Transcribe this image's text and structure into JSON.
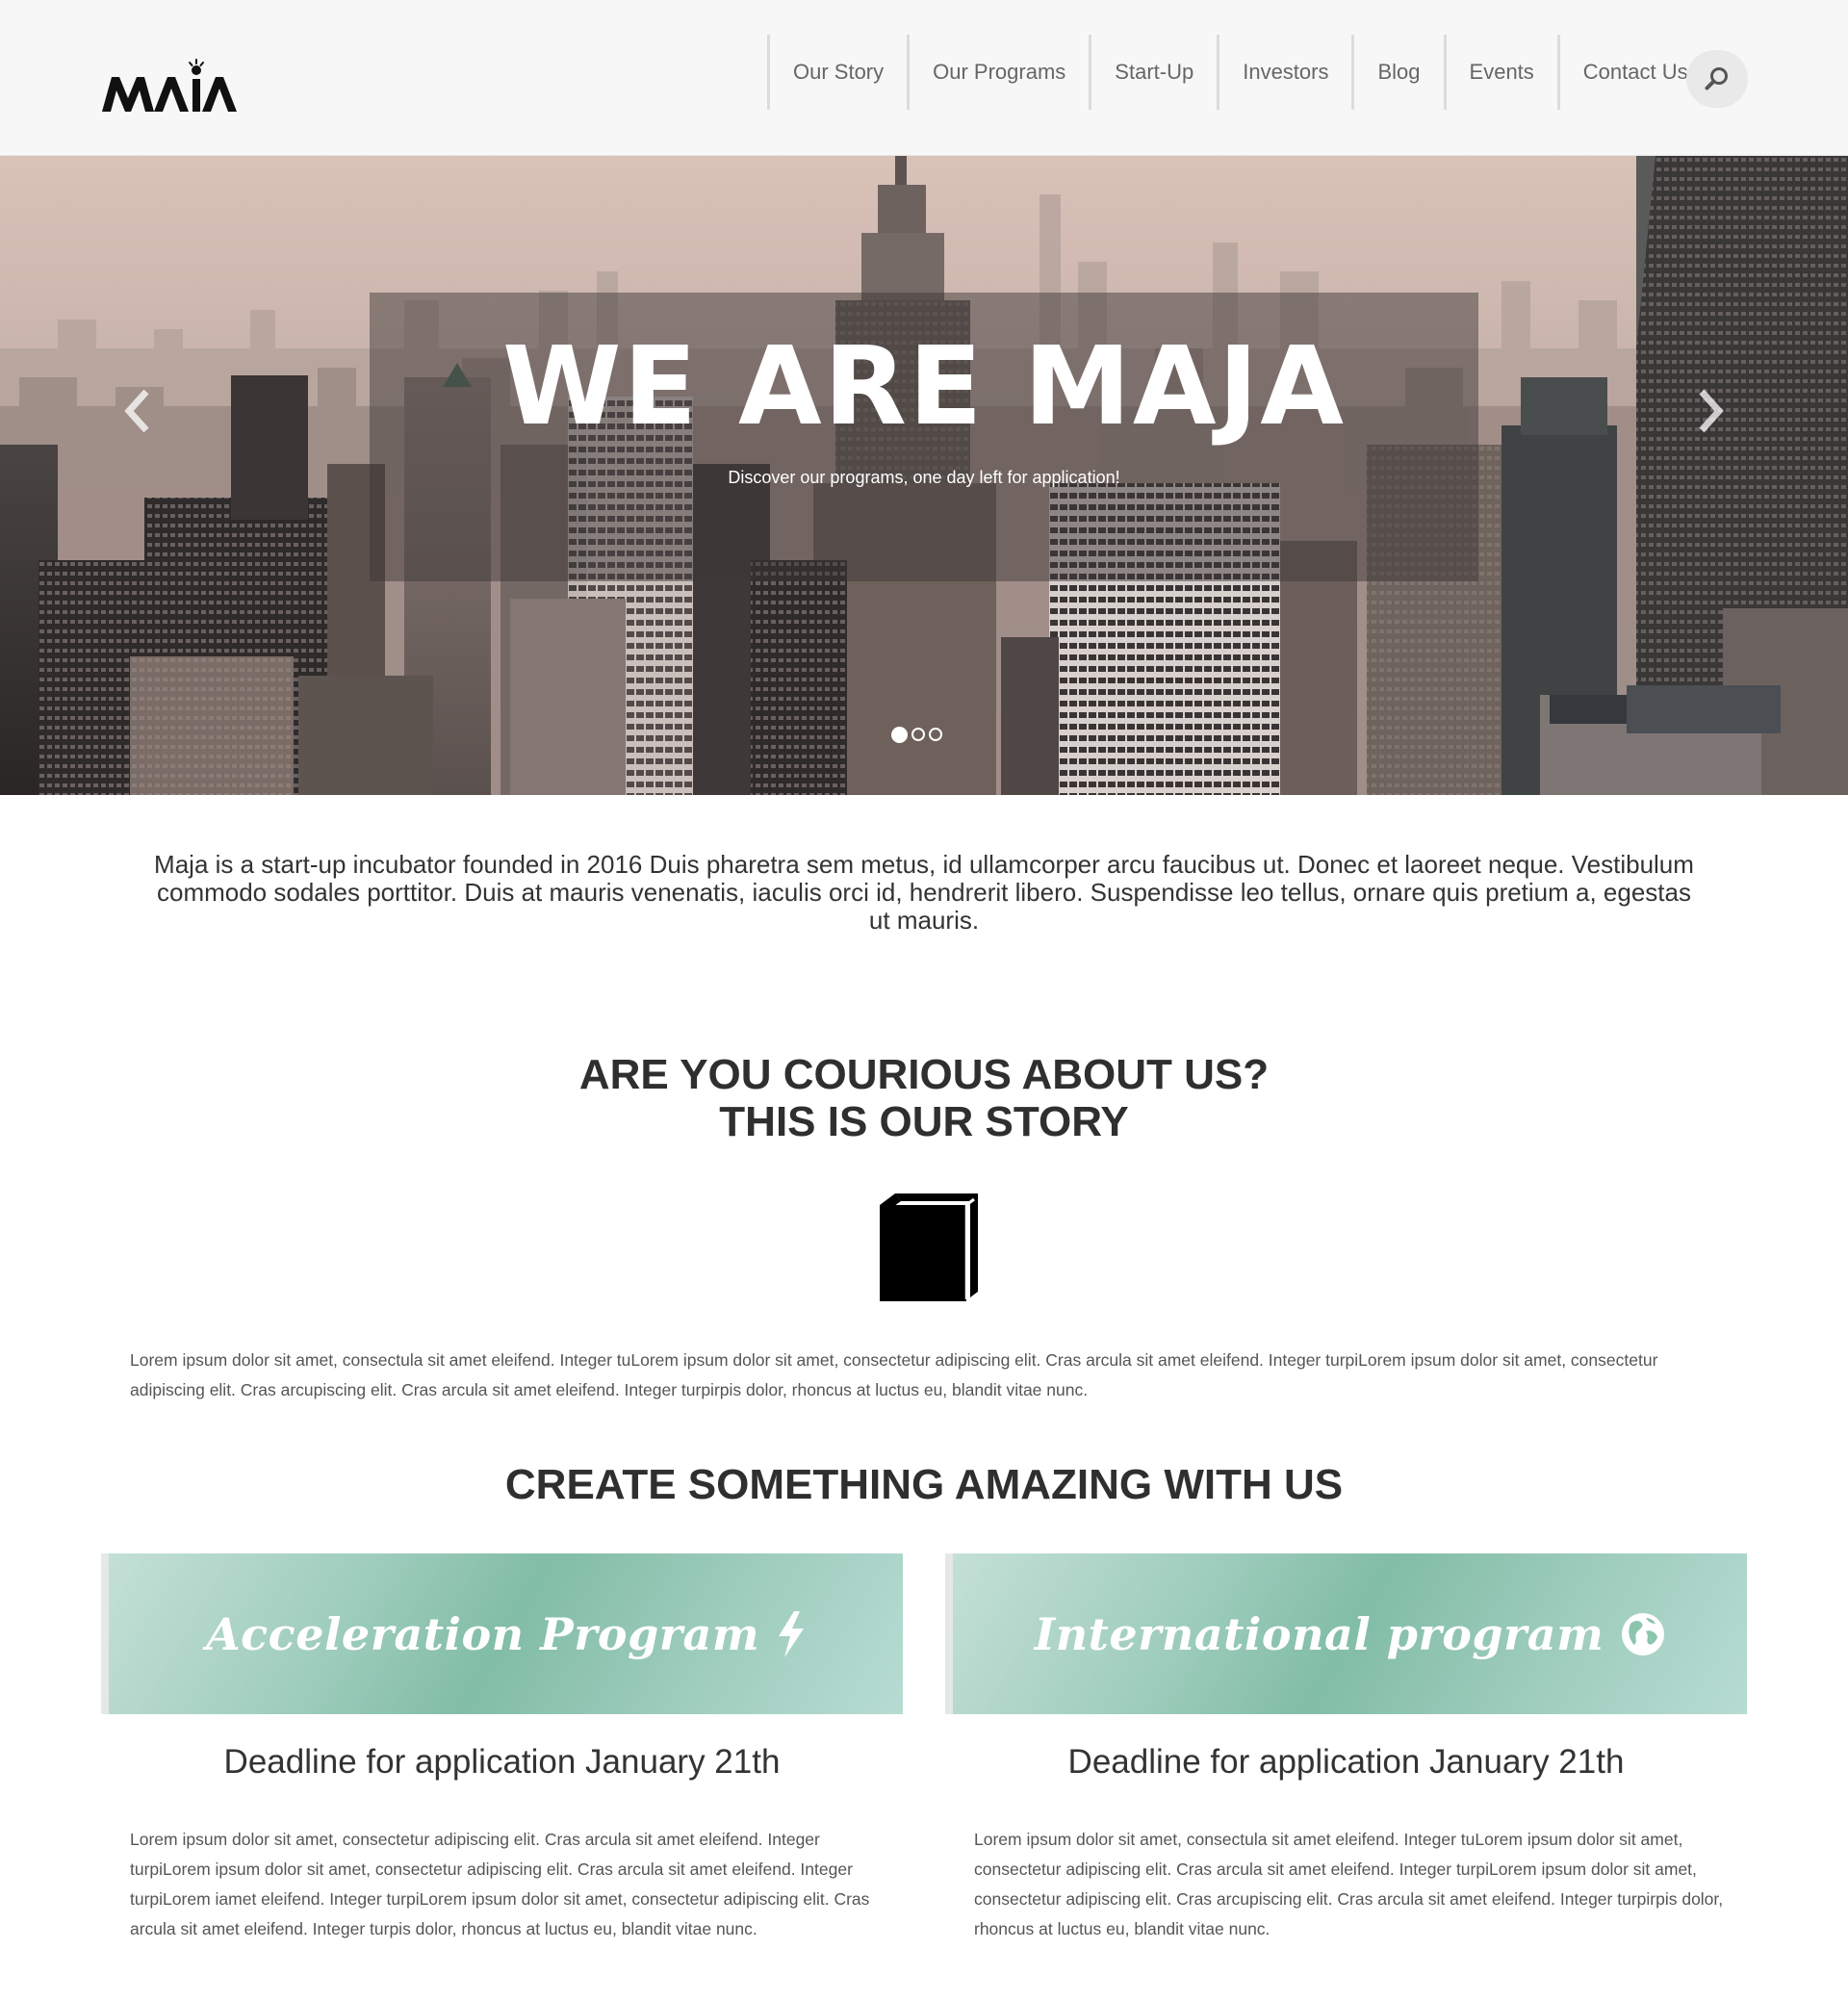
{
  "brand": {
    "logo_text": "MAJA"
  },
  "nav": {
    "items": [
      "Our Story",
      "Our Programs",
      "Start-Up",
      "Investors",
      "Blog",
      "Events",
      "Contact Us"
    ],
    "search_icon": "search-icon"
  },
  "hero": {
    "title": "WE ARE MAJA",
    "subtitle": "Discover our programs, one day left for application!",
    "slides_count": 3,
    "active_slide": 1,
    "prev_icon": "chevron-left-icon",
    "next_icon": "chevron-right-icon"
  },
  "intro": {
    "text": "Maja is a start-up incubator founded in 2016 Duis pharetra sem metus, id ullamcorper arcu faucibus ut. Donec et laoreet neque. Vestibulum commodo sodales porttitor. Duis at mauris venenatis, iaculis orci id, hendrerit libero. Suspendisse leo tellus, ornare quis pretium a, egestas ut mauris."
  },
  "story": {
    "heading_line1": "ARE YOU COURIOUS ABOUT US?",
    "heading_line2": "THIS IS OUR STORY",
    "icon": "book-icon",
    "text": "Lorem ipsum dolor sit amet, consectula sit amet eleifend. Integer tuLorem ipsum dolor sit amet, consectetur adipiscing elit. Cras arcula sit amet eleifend. Integer turpiLorem ipsum dolor sit amet, consectetur adipiscing elit. Cras arcupiscing elit. Cras arcula sit amet eleifend. Integer turpirpis dolor, rhoncus at luctus eu, blandit vitae nunc."
  },
  "create": {
    "heading": "CREATE SOMETHING AMAZING WITH US"
  },
  "programs": [
    {
      "title": "Acceleration Program",
      "icon": "lightning-bolt-icon",
      "deadline": "Deadline for application January 21th",
      "text": "Lorem ipsum dolor sit amet, consectetur adipiscing elit. Cras arcula sit amet eleifend. Integer turpiLorem ipsum dolor sit amet, consectetur adipiscing elit. Cras arcula sit amet eleifend. Integer turpiLorem iamet eleifend. Integer turpiLorem ipsum dolor sit amet, consectetur adipiscing elit. Cras arcula sit amet eleifend. Integer turpis dolor, rhoncus at luctus eu, blandit vitae nunc."
    },
    {
      "title": "International program",
      "icon": "globe-icon",
      "deadline": "Deadline for application January 21th",
      "text": "Lorem ipsum dolor sit amet, consectula sit amet eleifend. Integer tuLorem ipsum dolor sit amet, consectetur adipiscing elit. Cras arcula sit amet eleifend. Integer turpiLorem ipsum dolor sit amet, consectetur adipiscing elit. Cras arcupiscing elit. Cras arcula sit amet eleifend. Integer turpirpis dolor, rhoncus at luctus eu, blandit vitae nunc."
    }
  ],
  "colors": {
    "header_bg": "#f7f7f7",
    "nav_text": "#666666",
    "heading_text": "#2f2f2f",
    "program_banner": "#8cc4ae",
    "hero_overlay": "#3c3737"
  }
}
